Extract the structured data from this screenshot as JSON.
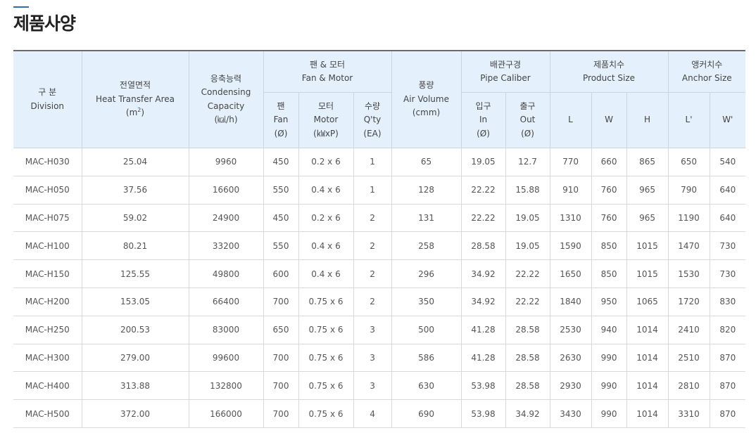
{
  "page": {
    "title": "제품사양"
  },
  "table": {
    "headers": {
      "division": {
        "ko": "구 분",
        "en": "Division"
      },
      "area": {
        "ko": "전열면적",
        "en": "Heat Transfer Area",
        "unit_pre": "(m",
        "unit_sup": "2",
        "unit_post": ")"
      },
      "capacity": {
        "ko": "응축능력",
        "en1": "Condensing",
        "en2": "Capacity",
        "unit": "(㎉/h)"
      },
      "fan_motor": {
        "ko": "팬 & 모터",
        "en": "Fan & Motor"
      },
      "fan": {
        "ko": "팬",
        "en": "Fan",
        "unit": "(Ø)"
      },
      "motor": {
        "ko": "모터",
        "en": "Motor",
        "unit": "(㎾xP)"
      },
      "qty": {
        "ko": "수량",
        "en": "Q'ty",
        "unit": "(EA)"
      },
      "air": {
        "ko": "풍량",
        "en": "Air Volume",
        "unit": "(cmm)"
      },
      "pipe": {
        "ko": "배관구경",
        "en": "Pipe Caliber"
      },
      "pipe_in": {
        "ko": "입구",
        "en": "In",
        "unit": "(Ø)"
      },
      "pipe_out": {
        "ko": "출구",
        "en": "Out",
        "unit": "(Ø)"
      },
      "product_size": {
        "ko": "제품치수",
        "en": "Product Size"
      },
      "L": "L",
      "W": "W",
      "H": "H",
      "anchor_size": {
        "ko": "앵커치수",
        "en": "Anchor Size"
      },
      "L2": "L'",
      "W2": "W'"
    },
    "rows": [
      [
        "MAC-H030",
        "25.04",
        "9960",
        "450",
        "0.2 x 6",
        "1",
        "65",
        "19.05",
        "12.7",
        "770",
        "660",
        "865",
        "650",
        "540"
      ],
      [
        "MAC-H050",
        "37.56",
        "16600",
        "550",
        "0.4 x 6",
        "1",
        "128",
        "22.22",
        "15.88",
        "910",
        "760",
        "965",
        "790",
        "640"
      ],
      [
        "MAC-H075",
        "59.02",
        "24900",
        "450",
        "0.2 x 6",
        "2",
        "131",
        "22.22",
        "19.05",
        "1310",
        "760",
        "965",
        "1190",
        "640"
      ],
      [
        "MAC-H100",
        "80.21",
        "33200",
        "550",
        "0.4 x 6",
        "2",
        "258",
        "28.58",
        "19.05",
        "1590",
        "850",
        "1015",
        "1470",
        "730"
      ],
      [
        "MAC-H150",
        "125.55",
        "49800",
        "600",
        "0.4 x 6",
        "2",
        "296",
        "34.92",
        "22.22",
        "1650",
        "850",
        "1015",
        "1530",
        "730"
      ],
      [
        "MAC-H200",
        "153.05",
        "66400",
        "700",
        "0.75 x 6",
        "2",
        "350",
        "34.92",
        "22.22",
        "1840",
        "950",
        "1065",
        "1720",
        "830"
      ],
      [
        "MAC-H250",
        "200.53",
        "83000",
        "650",
        "0.75 x 6",
        "3",
        "500",
        "41.28",
        "28.58",
        "2530",
        "940",
        "1014",
        "2410",
        "820"
      ],
      [
        "MAC-H300",
        "279.00",
        "99600",
        "700",
        "0.75 x 6",
        "3",
        "586",
        "41.28",
        "28.58",
        "2630",
        "990",
        "1014",
        "2510",
        "870"
      ],
      [
        "MAC-H400",
        "313.88",
        "132800",
        "700",
        "0.75 x 6",
        "3",
        "630",
        "53.98",
        "28.58",
        "2930",
        "990",
        "1014",
        "2810",
        "870"
      ],
      [
        "MAC-H500",
        "372.00",
        "166000",
        "700",
        "0.75 x 6",
        "4",
        "690",
        "53.98",
        "34.92",
        "3430",
        "990",
        "1014",
        "3310",
        "870"
      ]
    ]
  }
}
